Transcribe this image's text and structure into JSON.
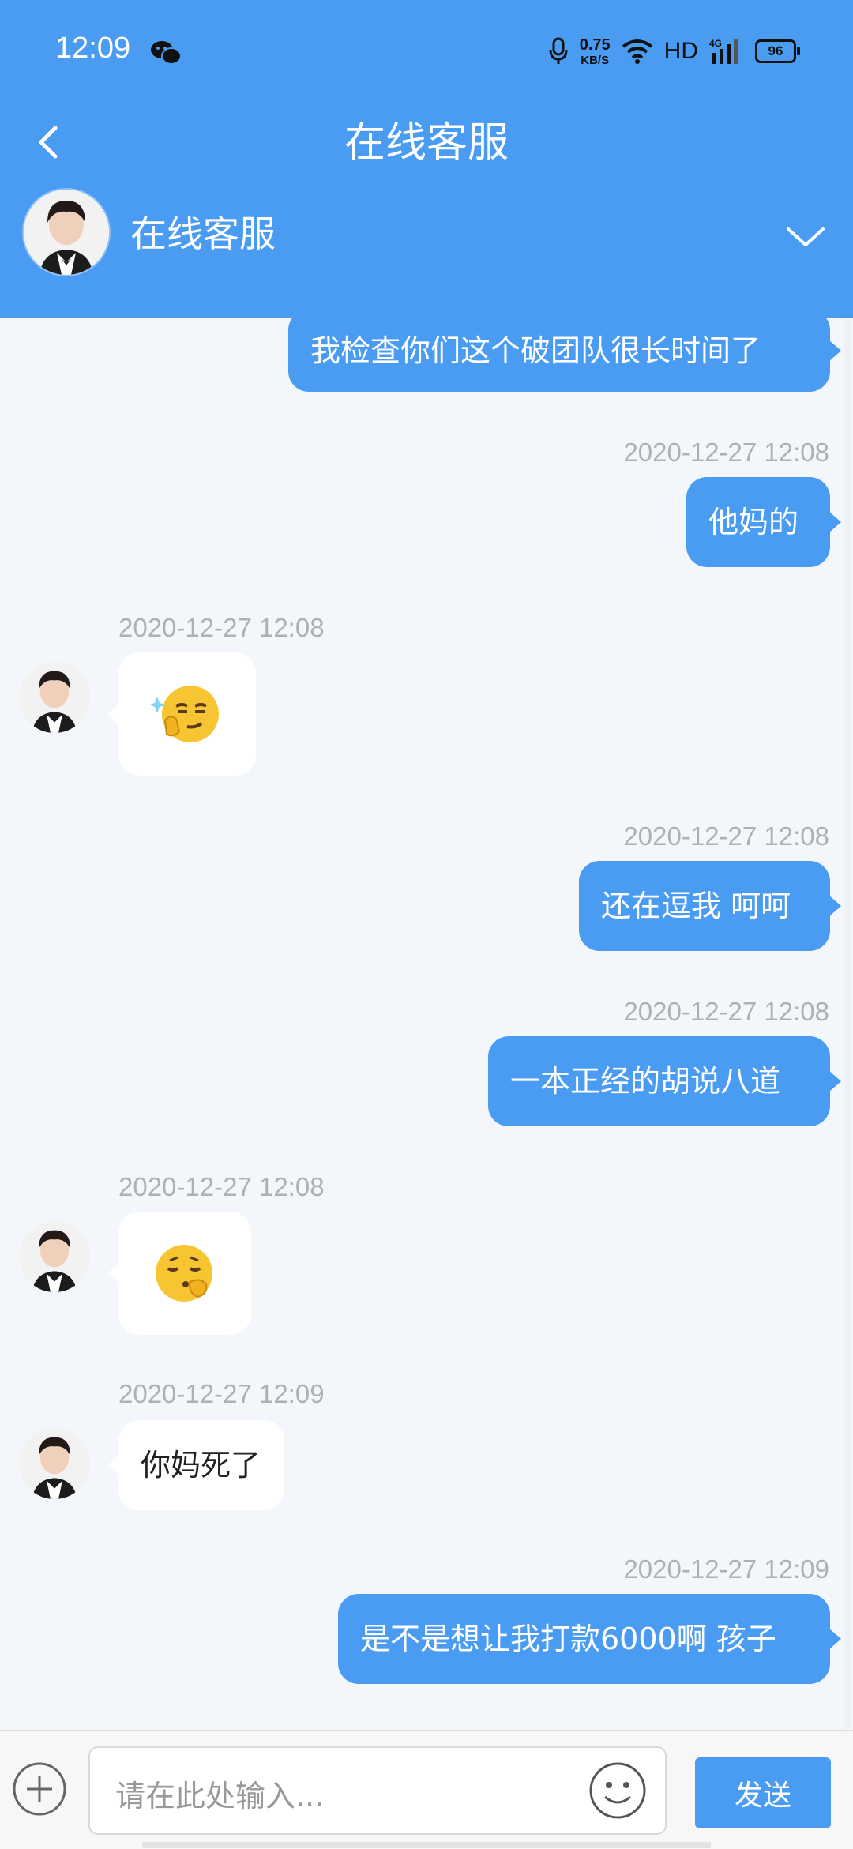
{
  "status_bar": {
    "time": "12:09",
    "net_speed_value": "0.75",
    "net_speed_unit": "KB/S",
    "hd_label": "HD",
    "network_label": "4G",
    "battery_level": "96",
    "icons": [
      "wechat-icon",
      "microphone-icon",
      "wifi-icon",
      "signal-icon",
      "battery-icon"
    ]
  },
  "header": {
    "title": "在线客服",
    "back_icon": "chevron-left-icon"
  },
  "agent": {
    "name": "在线客服",
    "expand_icon": "chevron-down-icon"
  },
  "messages": [
    {
      "side": "right",
      "text": "我检查你们这个破团队很长时间了"
    },
    {
      "side": "right",
      "time": "2020-12-27 12:08",
      "text": "他妈的"
    },
    {
      "side": "left",
      "time": "2020-12-27 12:08",
      "emoji": "thinking-smirk-emoji"
    },
    {
      "side": "right",
      "time": "2020-12-27 12:08",
      "text": "还在逗我 呵呵"
    },
    {
      "side": "right",
      "time": "2020-12-27 12:08",
      "text": "一本正经的胡说八道"
    },
    {
      "side": "left",
      "time": "2020-12-27 12:08",
      "emoji": "shush-emoji"
    },
    {
      "side": "left",
      "time": "2020-12-27 12:09",
      "text": "你妈死了"
    },
    {
      "side": "right",
      "time": "2020-12-27 12:09",
      "text": "是不是想让我打款6000啊 孩子"
    }
  ],
  "input": {
    "placeholder": "请在此处输入...",
    "send_label": "发送",
    "plus_icon": "plus-circle-icon",
    "emoji_icon": "smiley-icon"
  },
  "colors": {
    "primary": "#4a9cf3",
    "chat_background": "#f3f6fa",
    "timestamp": "#b0b0b0"
  }
}
